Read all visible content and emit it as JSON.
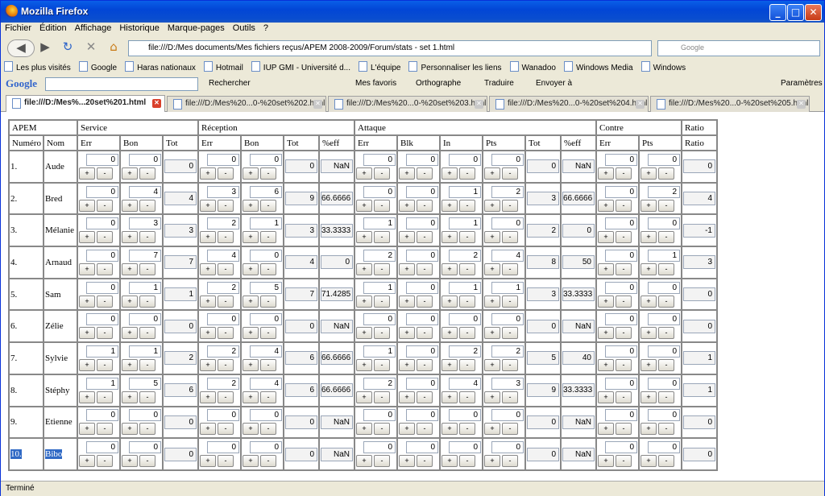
{
  "window": {
    "title": "Mozilla Firefox"
  },
  "menu": [
    "Fichier",
    "Édition",
    "Affichage",
    "Historique",
    "Marque-pages",
    "Outils",
    "?"
  ],
  "nav": {
    "url": "file:///D:/Mes documents/Mes fichiers reçus/APEM 2008-2009/Forum/stats - set 1.html",
    "search_placeholder": "Google"
  },
  "bookmarks": [
    "Les plus visités",
    "Google",
    "Haras nationaux",
    "Hotmail",
    "IUP GMI - Université d...",
    "L'équipe",
    "Personnaliser les liens",
    "Wanadoo",
    "Windows Media",
    "Windows"
  ],
  "google_toolbar": {
    "logo": "Google",
    "rechercher": "Rechercher",
    "favoris": "Mes favoris",
    "orthographe": "Orthographe",
    "traduire": "Traduire",
    "envoyer": "Envoyer à",
    "parametres": "Paramètres"
  },
  "tabs": [
    {
      "label": "file:///D:/Mes%...20set%201.html",
      "active": true
    },
    {
      "label": "file:///D:/Mes%20...0-%20set%202.html",
      "active": false
    },
    {
      "label": "file:///D:/Mes%20...0-%20set%203.html",
      "active": false
    },
    {
      "label": "file:///D:/Mes%20...0-%20set%204.html",
      "active": false
    },
    {
      "label": "file:///D:/Mes%20...0-%20set%205.html",
      "active": false
    }
  ],
  "status": "Terminé",
  "table": {
    "groups": [
      "APEM",
      "Service",
      "Réception",
      "Attaque",
      "Contre",
      "Ratio"
    ],
    "headers": [
      "Numéro",
      "Nom",
      "Err",
      "Bon",
      "Tot",
      "Err",
      "Bon",
      "Tot",
      "%eff",
      "Err",
      "Blk",
      "In",
      "Pts",
      "Tot",
      "%eff",
      "Err",
      "Pts",
      "Ratio"
    ],
    "button_plus": "+",
    "button_minus": "-",
    "players": [
      {
        "num": "1.",
        "name": "Aude",
        "s_err": "0",
        "s_bon": "0",
        "s_tot": "0",
        "r_err": "0",
        "r_bon": "0",
        "r_tot": "0",
        "r_eff": "NaN",
        "a_err": "0",
        "a_blk": "0",
        "a_in": "0",
        "a_pts": "0",
        "a_tot": "0",
        "a_eff": "NaN",
        "c_err": "0",
        "c_pts": "0",
        "ratio": "0"
      },
      {
        "num": "2.",
        "name": "Bred",
        "s_err": "0",
        "s_bon": "4",
        "s_tot": "4",
        "r_err": "3",
        "r_bon": "6",
        "r_tot": "9",
        "r_eff": "66.6666",
        "a_err": "0",
        "a_blk": "0",
        "a_in": "1",
        "a_pts": "2",
        "a_tot": "3",
        "a_eff": "66.6666",
        "c_err": "0",
        "c_pts": "2",
        "ratio": "4"
      },
      {
        "num": "3.",
        "name": "Mélanie",
        "s_err": "0",
        "s_bon": "3",
        "s_tot": "3",
        "r_err": "2",
        "r_bon": "1",
        "r_tot": "3",
        "r_eff": "33.3333",
        "a_err": "1",
        "a_blk": "0",
        "a_in": "1",
        "a_pts": "0",
        "a_tot": "2",
        "a_eff": "0",
        "c_err": "0",
        "c_pts": "0",
        "ratio": "-1"
      },
      {
        "num": "4.",
        "name": "Arnaud",
        "s_err": "0",
        "s_bon": "7",
        "s_tot": "7",
        "r_err": "4",
        "r_bon": "0",
        "r_tot": "4",
        "r_eff": "0",
        "a_err": "2",
        "a_blk": "0",
        "a_in": "2",
        "a_pts": "4",
        "a_tot": "8",
        "a_eff": "50",
        "c_err": "0",
        "c_pts": "1",
        "ratio": "3"
      },
      {
        "num": "5.",
        "name": "Sam",
        "s_err": "0",
        "s_bon": "1",
        "s_tot": "1",
        "r_err": "2",
        "r_bon": "5",
        "r_tot": "7",
        "r_eff": "71.4285",
        "a_err": "1",
        "a_blk": "0",
        "a_in": "1",
        "a_pts": "1",
        "a_tot": "3",
        "a_eff": "33.3333",
        "c_err": "0",
        "c_pts": "0",
        "ratio": "0"
      },
      {
        "num": "6.",
        "name": "Zélie",
        "s_err": "0",
        "s_bon": "0",
        "s_tot": "0",
        "r_err": "0",
        "r_bon": "0",
        "r_tot": "0",
        "r_eff": "NaN",
        "a_err": "0",
        "a_blk": "0",
        "a_in": "0",
        "a_pts": "0",
        "a_tot": "0",
        "a_eff": "NaN",
        "c_err": "0",
        "c_pts": "0",
        "ratio": "0"
      },
      {
        "num": "7.",
        "name": "Sylvie",
        "s_err": "1",
        "s_bon": "1",
        "s_tot": "2",
        "r_err": "2",
        "r_bon": "4",
        "r_tot": "6",
        "r_eff": "66.6666",
        "a_err": "1",
        "a_blk": "0",
        "a_in": "2",
        "a_pts": "2",
        "a_tot": "5",
        "a_eff": "40",
        "c_err": "0",
        "c_pts": "0",
        "ratio": "1"
      },
      {
        "num": "8.",
        "name": "Stéphy",
        "s_err": "1",
        "s_bon": "5",
        "s_tot": "6",
        "r_err": "2",
        "r_bon": "4",
        "r_tot": "6",
        "r_eff": "66.6666",
        "a_err": "2",
        "a_blk": "0",
        "a_in": "4",
        "a_pts": "3",
        "a_tot": "9",
        "a_eff": "33.3333",
        "c_err": "0",
        "c_pts": "0",
        "ratio": "1"
      },
      {
        "num": "9.",
        "name": "Etienne",
        "s_err": "0",
        "s_bon": "0",
        "s_tot": "0",
        "r_err": "0",
        "r_bon": "0",
        "r_tot": "0",
        "r_eff": "NaN",
        "a_err": "0",
        "a_blk": "0",
        "a_in": "0",
        "a_pts": "0",
        "a_tot": "0",
        "a_eff": "NaN",
        "c_err": "0",
        "c_pts": "0",
        "ratio": "0"
      },
      {
        "num": "10.",
        "name": "Bibo",
        "s_err": "0",
        "s_bon": "0",
        "s_tot": "0",
        "r_err": "0",
        "r_bon": "0",
        "r_tot": "0",
        "r_eff": "NaN",
        "a_err": "0",
        "a_blk": "0",
        "a_in": "0",
        "a_pts": "0",
        "a_tot": "0",
        "a_eff": "NaN",
        "c_err": "0",
        "c_pts": "0",
        "ratio": "0"
      }
    ]
  }
}
